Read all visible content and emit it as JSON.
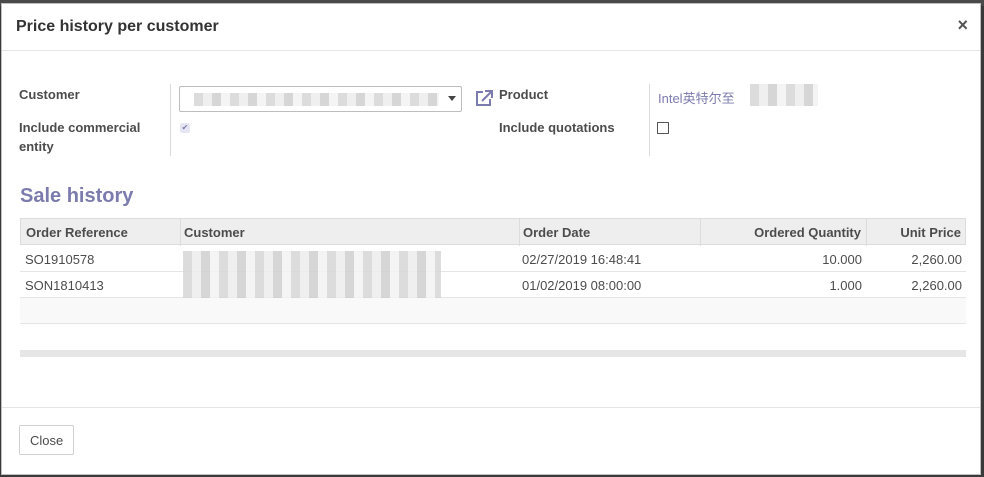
{
  "dialog": {
    "title": "Price history per customer",
    "close_glyph": "×"
  },
  "form": {
    "customer_label": "Customer",
    "include_commercial_label_line1": "Include commercial",
    "include_commercial_label_line2": "entity",
    "include_commercial_checked": true,
    "product_label": "Product",
    "product_value": "Intel英特尔至",
    "include_quotations_label": "Include quotations",
    "include_quotations_checked": false
  },
  "section": {
    "title": "Sale history"
  },
  "table": {
    "columns": [
      "Order Reference",
      "Customer",
      "Order Date",
      "Ordered Quantity",
      "Unit Price"
    ],
    "rows": [
      {
        "ref": "SO1910578",
        "date": "02/27/2019 16:48:41",
        "qty": "10.000",
        "price": "2,260.00"
      },
      {
        "ref": "SON1810413",
        "date": "01/02/2019 08:00:00",
        "qty": "1.000",
        "price": "2,260.00"
      }
    ]
  },
  "footer": {
    "close_label": "Close"
  },
  "colors": {
    "accent": "#7c7bad"
  }
}
